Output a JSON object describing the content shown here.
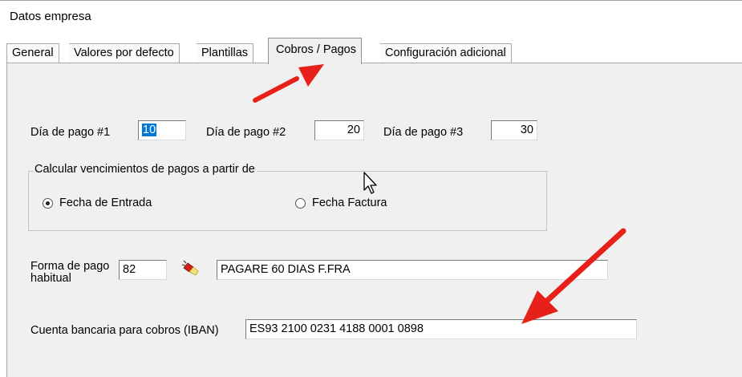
{
  "window": {
    "title": "Datos empresa"
  },
  "tabs": [
    {
      "label": "General"
    },
    {
      "label": "Valores por defecto"
    },
    {
      "label": "Plantillas"
    },
    {
      "label": "Cobros / Pagos",
      "active": true
    },
    {
      "label": "Configuración adicional"
    }
  ],
  "payment_days": {
    "day1_label": "Día de pago #1",
    "day1_value": "10",
    "day2_label": "Día de pago #2",
    "day2_value": "20",
    "day3_label": "Día de pago #3",
    "day3_value": "30"
  },
  "due_group": {
    "legend": "Calcular vencimientos de pagos a partir de",
    "options": [
      {
        "label": "Fecha de Entrada",
        "selected": true
      },
      {
        "label": "Fecha Factura",
        "selected": false
      }
    ]
  },
  "payment_method": {
    "label_line1": "Forma de pago",
    "label_line2": "habitual",
    "code": "82",
    "description": "PAGARE 60 DIAS F.FRA",
    "lookup_icon": "flashlight-icon"
  },
  "bank": {
    "label": "Cuenta bancaria para cobros (IBAN)",
    "value": "ES93 2100 0231 4188 0001 0898"
  },
  "annotations": {
    "arrow_color": "#e8201a"
  }
}
